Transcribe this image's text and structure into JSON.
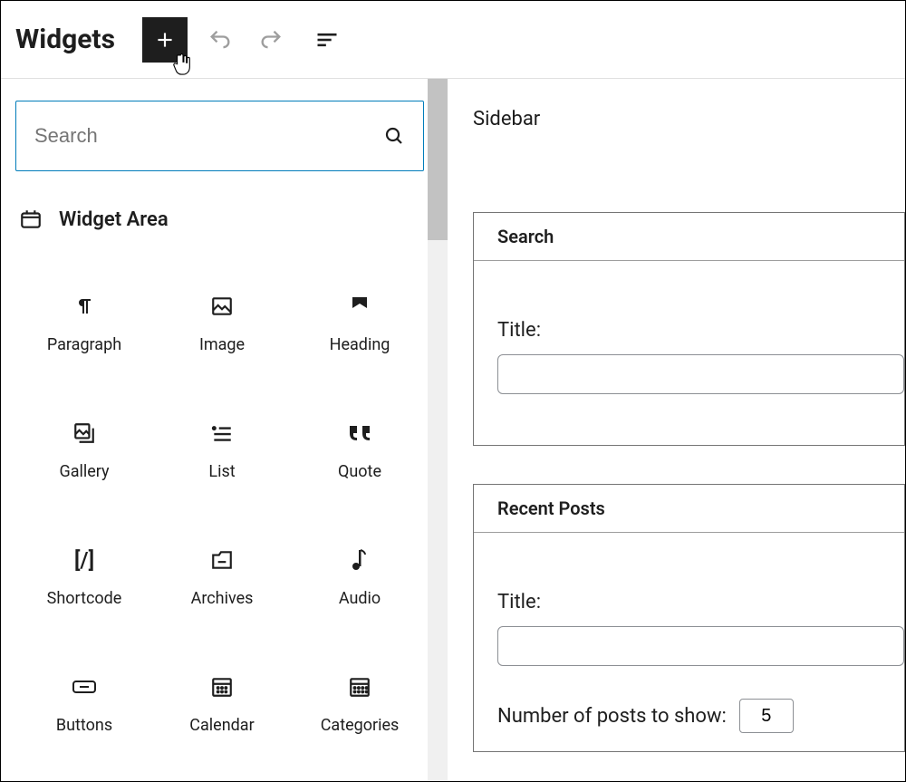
{
  "header": {
    "title": "Widgets"
  },
  "inserter": {
    "search_placeholder": "Search",
    "section_title": "Widget Area",
    "blocks": [
      {
        "label": "Paragraph",
        "icon": "paragraph"
      },
      {
        "label": "Image",
        "icon": "image"
      },
      {
        "label": "Heading",
        "icon": "heading"
      },
      {
        "label": "Gallery",
        "icon": "gallery"
      },
      {
        "label": "List",
        "icon": "list"
      },
      {
        "label": "Quote",
        "icon": "quote"
      },
      {
        "label": "Shortcode",
        "icon": "shortcode"
      },
      {
        "label": "Archives",
        "icon": "archives"
      },
      {
        "label": "Audio",
        "icon": "audio"
      },
      {
        "label": "Buttons",
        "icon": "buttons"
      },
      {
        "label": "Calendar",
        "icon": "calendar"
      },
      {
        "label": "Categories",
        "icon": "categories"
      }
    ]
  },
  "sidebar": {
    "area_title": "Sidebar",
    "widgets": [
      {
        "title": "Search",
        "fields": {
          "title_label": "Title:",
          "title_value": ""
        }
      },
      {
        "title": "Recent Posts",
        "fields": {
          "title_label": "Title:",
          "title_value": "",
          "posts_label": "Number of posts to show:",
          "posts_value": "5"
        }
      }
    ]
  }
}
